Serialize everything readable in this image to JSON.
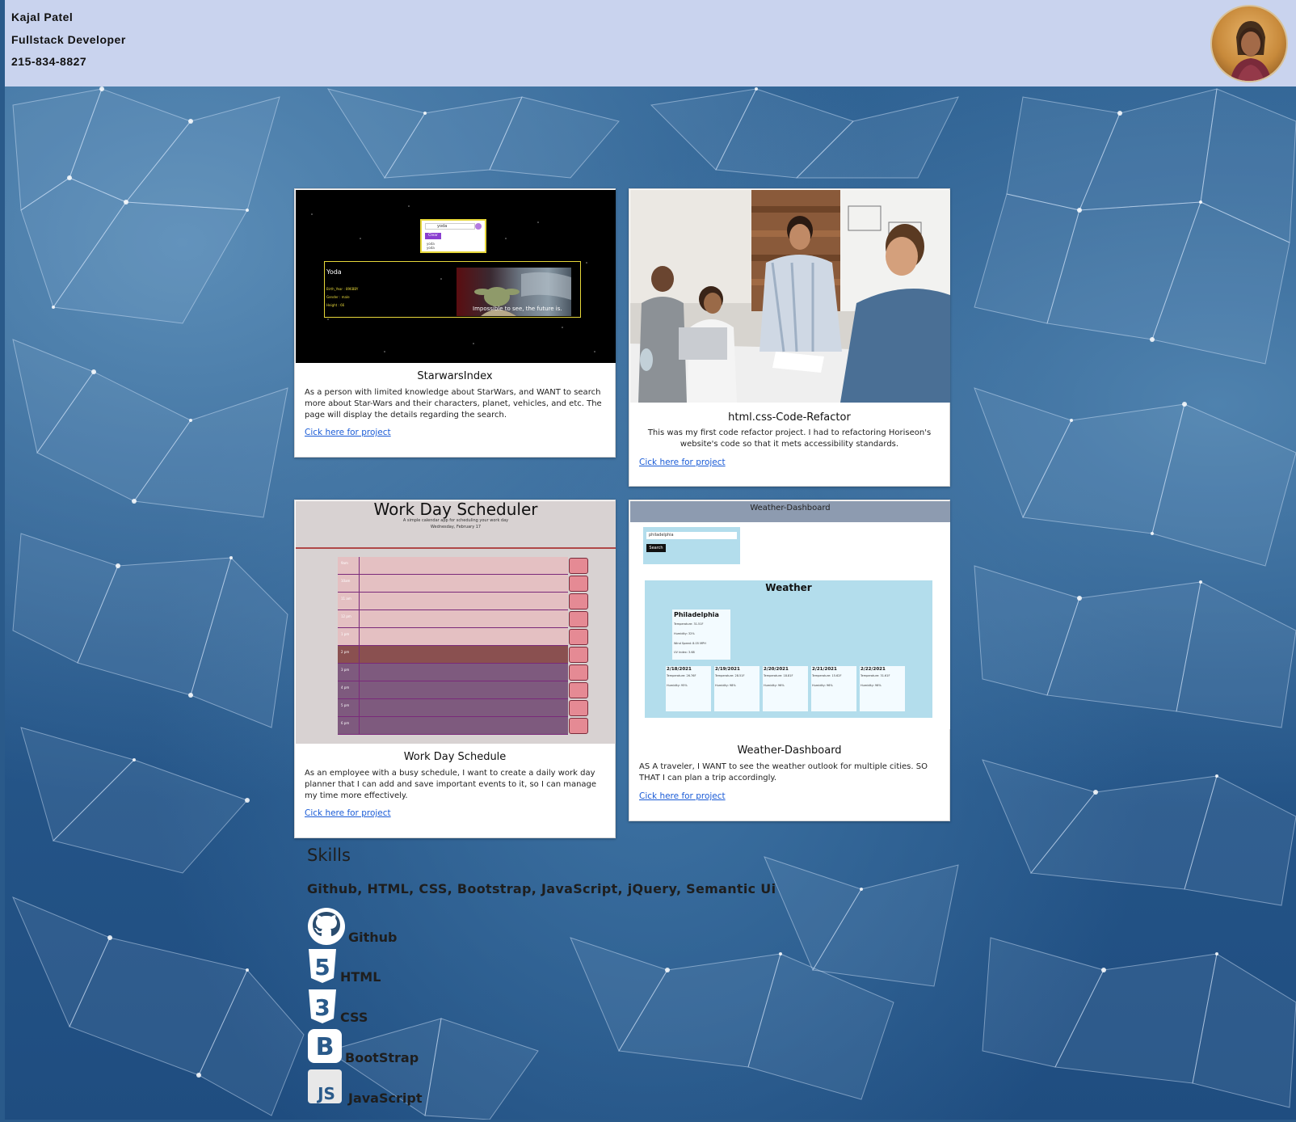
{
  "header": {
    "name": "Kajal Patel",
    "role": "Fullstack Developer",
    "phone": "215-834-8827"
  },
  "projects": [
    {
      "title": "StarwarsIndex",
      "description": "As a person with limited knowledge about StarWars, and WANT to search more about Star-Wars and their characters, planet, vehicles, and etc. The page will display the details regarding the search.",
      "link": "Cick here for project",
      "screenshot": {
        "search_value": "yoda",
        "clear_label": "Clear",
        "suggestions": [
          "yoda",
          "yoda"
        ],
        "result_title": "Yoda",
        "result_lines": [
          "Birth_Year : 896BBY",
          "Gender : male",
          "Height : 66"
        ],
        "caption": "Impossible to see, the future is."
      }
    },
    {
      "title": "html.css-Code-Refactor",
      "description": "This was my first code refactor project. I had to refactoring Horiseon's website's code so that it mets accessibility standards.",
      "link": "Cick here for project"
    },
    {
      "title": "Work Day Schedule",
      "description": "As an employee with a busy schedule, I want to create a daily work day planner that I can add and save important events to it, so I can manage my time more effectively.",
      "link": "Cick here for project",
      "screenshot": {
        "heading": "Work Day Scheduler",
        "subheading": "A simple calendar app for scheduling your work day",
        "date": "Wednesday, February 17",
        "hours": [
          "9am",
          "10am",
          "11 am",
          "12 pm",
          "1 pm",
          "2 pm",
          "3 pm",
          "4 pm",
          "5 pm",
          "6 pm"
        ]
      }
    },
    {
      "title": "Weather-Dashboard",
      "description": "AS A traveler, I WANT to see the weather outlook for multiple cities. SO THAT I can plan a trip accordingly.",
      "link": "Cick here for project",
      "screenshot": {
        "bar_title": "Weather-Dashboard",
        "search_value": "philadelphia",
        "search_button": "Search",
        "panel_title": "Weather",
        "city": "Philadelphia",
        "current": [
          "Temperature: 31.51F",
          "Humidity: 32%",
          "Wind Speed: 8.05 MPH",
          "UV Index: 3.68"
        ],
        "forecast": [
          {
            "date": "2/18/2021",
            "temp": "Temperature: 26.76F",
            "hum": "Humidity: 95%"
          },
          {
            "date": "2/19/2021",
            "temp": "Temperature: 28.51F",
            "hum": "Humidity: 98%"
          },
          {
            "date": "2/20/2021",
            "temp": "Temperature: 18.81F",
            "hum": "Humidity: 96%"
          },
          {
            "date": "2/21/2021",
            "temp": "Temperature: 15.62F",
            "hum": "Humidity: 96%"
          },
          {
            "date": "2/22/2021",
            "temp": "Temperature: 31.61F",
            "hum": "Humidity: 96%"
          }
        ]
      }
    }
  ],
  "skills": {
    "title": "Skills",
    "list": "Github, HTML, CSS, Bootstrap, JavaScript, jQuery, Semantic Ui",
    "items": [
      {
        "label": "Github",
        "icon": "github-icon"
      },
      {
        "label": "HTML",
        "icon": "html5-icon"
      },
      {
        "label": "CSS",
        "icon": "css3-icon"
      },
      {
        "label": "BootStrap",
        "icon": "bootstrap-icon"
      },
      {
        "label": "JavaScript",
        "icon": "javascript-icon"
      }
    ]
  },
  "colors": {
    "header_bg": "#c9d3ee",
    "page_bg": "#2a5a8a",
    "link": "#1a5bd6"
  }
}
